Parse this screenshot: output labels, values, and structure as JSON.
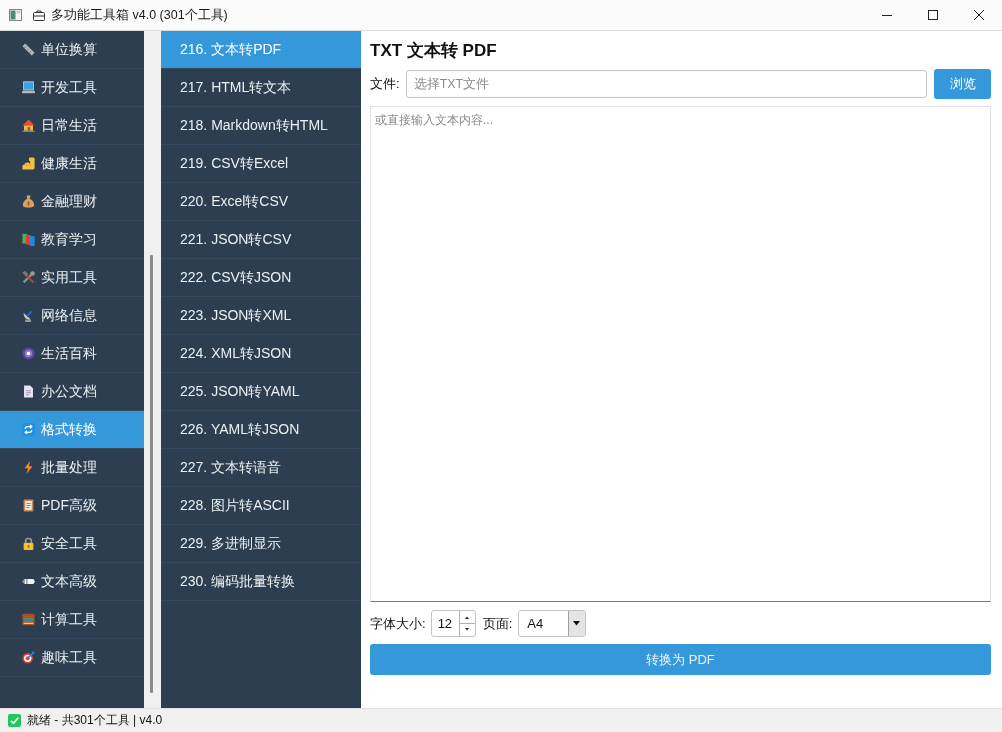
{
  "window": {
    "title": "多功能工具箱 v4.0 (301个工具)"
  },
  "categories": [
    {
      "label": "单位换算",
      "selected": false
    },
    {
      "label": "开发工具",
      "selected": false
    },
    {
      "label": "日常生活",
      "selected": false
    },
    {
      "label": "健康生活",
      "selected": false
    },
    {
      "label": "金融理财",
      "selected": false
    },
    {
      "label": "教育学习",
      "selected": false
    },
    {
      "label": "实用工具",
      "selected": false
    },
    {
      "label": "网络信息",
      "selected": false
    },
    {
      "label": "生活百科",
      "selected": false
    },
    {
      "label": "办公文档",
      "selected": false
    },
    {
      "label": "格式转换",
      "selected": true
    },
    {
      "label": "批量处理",
      "selected": false
    },
    {
      "label": "PDF高级",
      "selected": false
    },
    {
      "label": "安全工具",
      "selected": false
    },
    {
      "label": "文本高级",
      "selected": false
    },
    {
      "label": "计算工具",
      "selected": false
    },
    {
      "label": "趣味工具",
      "selected": false
    }
  ],
  "tools": [
    {
      "label": "216. 文本转PDF",
      "selected": true
    },
    {
      "label": "217. HTML转文本",
      "selected": false
    },
    {
      "label": "218. Markdown转HTML",
      "selected": false
    },
    {
      "label": "219. CSV转Excel",
      "selected": false
    },
    {
      "label": "220. Excel转CSV",
      "selected": false
    },
    {
      "label": "221. JSON转CSV",
      "selected": false
    },
    {
      "label": "222. CSV转JSON",
      "selected": false
    },
    {
      "label": "223. JSON转XML",
      "selected": false
    },
    {
      "label": "224. XML转JSON",
      "selected": false
    },
    {
      "label": "225. JSON转YAML",
      "selected": false
    },
    {
      "label": "226. YAML转JSON",
      "selected": false
    },
    {
      "label": "227. 文本转语音",
      "selected": false
    },
    {
      "label": "228. 图片转ASCII",
      "selected": false
    },
    {
      "label": "229. 多进制显示",
      "selected": false
    },
    {
      "label": "230. 编码批量转换",
      "selected": false
    }
  ],
  "panel": {
    "title": "TXT 文本转 PDF",
    "file_label": "文件:",
    "file_field": {
      "placeholder": "选择TXT文件"
    },
    "browse_button": "浏览",
    "text_area": {
      "placeholder": "或直接输入文本内容..."
    },
    "font_size_label": "字体大小:",
    "font_size": "12",
    "page_label": "页面:",
    "page_size": "A4",
    "convert_button": "转换为 PDF"
  },
  "status_bar": {
    "text": "就绪 - 共301个工具 | v4.0"
  }
}
